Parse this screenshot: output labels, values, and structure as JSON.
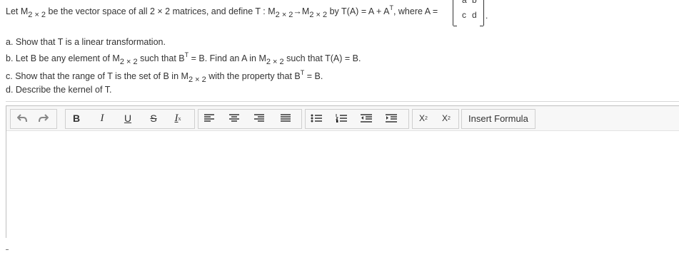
{
  "question": {
    "l1_a": "Let M",
    "l1_b": " be the vector space of all 2 × 2 matrices, and define T : M",
    "l1_c": "→M",
    "l1_d": " by T(A) = A + A",
    "l1_e": ", where A =",
    "sub2x2": "2 × 2",
    "supT": "T",
    "matrix": [
      "a",
      "b",
      "c",
      "d"
    ],
    "period": ".",
    "part_a": "a. Show that T is a linear transformation.",
    "part_b_1": "b. Let B be any element of M",
    "part_b_2": " such that B",
    "part_b_3": " = B. Find an A in M",
    "part_b_4": " such that T(A) = B.",
    "part_c_1": "c. Show that the range of T is the set of B in M",
    "part_c_2": " with the property that B",
    "part_c_3": " = B.",
    "part_d": "d. Describe the kernel of T."
  },
  "toolbar": {
    "bold_label": "B",
    "italic_label": "I",
    "underline_label": "U",
    "strike_label": "S",
    "clear_format_label": "I",
    "subscript_label": "X",
    "subscript_mark": "2",
    "superscript_label": "X",
    "superscript_mark": "2",
    "insert_formula_label": "Insert Formula"
  }
}
